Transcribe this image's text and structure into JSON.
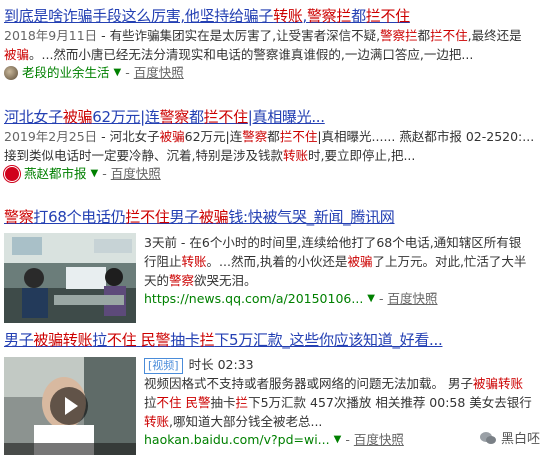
{
  "results": [
    {
      "title": [
        {
          "t": "到底是啥诈骗手段这么厉害,他坚持给骗子"
        },
        {
          "t": "转账",
          "hl": true
        },
        {
          "t": ","
        },
        {
          "t": "警察拦",
          "hl": true
        },
        {
          "t": "都"
        },
        {
          "t": "拦不住",
          "hl": true
        }
      ],
      "date": "2018年9月11日",
      "abstract_line1": [
        {
          "t": " - 有些诈骗集团实在是太厉害了,让受害者深信不疑,"
        },
        {
          "t": "警察拦",
          "hl": true
        },
        {
          "t": "都"
        },
        {
          "t": "拦不住",
          "hl": true
        },
        {
          "t": ",最终还是"
        }
      ],
      "abstract_line2": [
        {
          "t": "被骗",
          "hl": true
        },
        {
          "t": "。...然而小唐已经无法分清现实和电话的警察谁真谁假的,一边满口答应,一边把..."
        }
      ],
      "source": "老段的业余生活",
      "snapshot": "百度快照"
    },
    {
      "title": [
        {
          "t": "河北女子"
        },
        {
          "t": "被骗",
          "hl": true
        },
        {
          "t": "62万元|连"
        },
        {
          "t": "警察",
          "hl": true
        },
        {
          "t": "都"
        },
        {
          "t": "拦不住",
          "hl": true
        },
        {
          "t": "|真相曝光..."
        }
      ],
      "date": "2019年2月25日",
      "abstract_line1": [
        {
          "t": " - 河北女子"
        },
        {
          "t": "被骗",
          "hl": true
        },
        {
          "t": "62万元|连"
        },
        {
          "t": "警察",
          "hl": true
        },
        {
          "t": "都"
        },
        {
          "t": "拦不住",
          "hl": true
        },
        {
          "t": "|真相曝光...... 燕赵都市报 02-2520:..."
        }
      ],
      "abstract_line2": [
        {
          "t": "接到类似电话时一定要冷静、沉着,特别是涉及钱款"
        },
        {
          "t": "转账",
          "hl": true
        },
        {
          "t": "时,要立即停止,把..."
        }
      ],
      "source": "燕赵都市报",
      "snapshot": "百度快照"
    },
    {
      "title": [
        {
          "t": "警察",
          "hl": true
        },
        {
          "t": "打68个电话仍"
        },
        {
          "t": "拦不住",
          "hl": true
        },
        {
          "t": "男子"
        },
        {
          "t": "被骗",
          "hl": true
        },
        {
          "t": "钱:快被气哭_新闻_腾讯网"
        }
      ],
      "abstract_line1": [
        {
          "t": "3天前 - 在6个小时的时间里,连续给他打了68个电话,通知辖区所有银"
        }
      ],
      "abstract_line2": [
        {
          "t": "行阻止"
        },
        {
          "t": "转账",
          "hl": true
        },
        {
          "t": "。...然而,执着的小伙还是"
        },
        {
          "t": "被骗",
          "hl": true
        },
        {
          "t": "了上万元。对此,忙活了大半"
        }
      ],
      "abstract_line3": [
        {
          "t": "天的"
        },
        {
          "t": "警察",
          "hl": true
        },
        {
          "t": "欲哭无泪。"
        }
      ],
      "url": "https://news.qq.com/a/20150106...",
      "snapshot": "百度快照"
    },
    {
      "title": [
        {
          "t": "男子"
        },
        {
          "t": "被骗转账",
          "hl": true
        },
        {
          "t": "拉"
        },
        {
          "t": "不住",
          "hl": true
        },
        {
          "t": " "
        },
        {
          "t": "民警",
          "hl": true
        },
        {
          "t": "抽卡"
        },
        {
          "t": "拦",
          "hl": true
        },
        {
          "t": "下5万汇款_这些你应该知道_好看..."
        }
      ],
      "tag": "[视频]",
      "duration": "时长 02:33",
      "abstract_line1": [
        {
          "t": "视频因格式不支持或者服务器或网络的问题无法加载。 男子"
        },
        {
          "t": "被骗转账",
          "hl": true
        }
      ],
      "abstract_line2": [
        {
          "t": "拉"
        },
        {
          "t": "不住",
          "hl": true
        },
        {
          "t": " "
        },
        {
          "t": "民警",
          "hl": true
        },
        {
          "t": "抽卡"
        },
        {
          "t": "拦",
          "hl": true
        },
        {
          "t": "下5万汇款 457次播放 相关推荐 00:58 美女去银行"
        }
      ],
      "abstract_line3": [
        {
          "t": "转账",
          "hl": true
        },
        {
          "t": ",哪知道大部分钱全被老总..."
        }
      ],
      "url": "haokan.baidu.com/v?pd=wi...",
      "snapshot": "百度快照"
    }
  ],
  "watermark": "黑白呸",
  "colors": {
    "link": "#2440b3",
    "highlight": "#cc0000",
    "source": "#008000"
  }
}
